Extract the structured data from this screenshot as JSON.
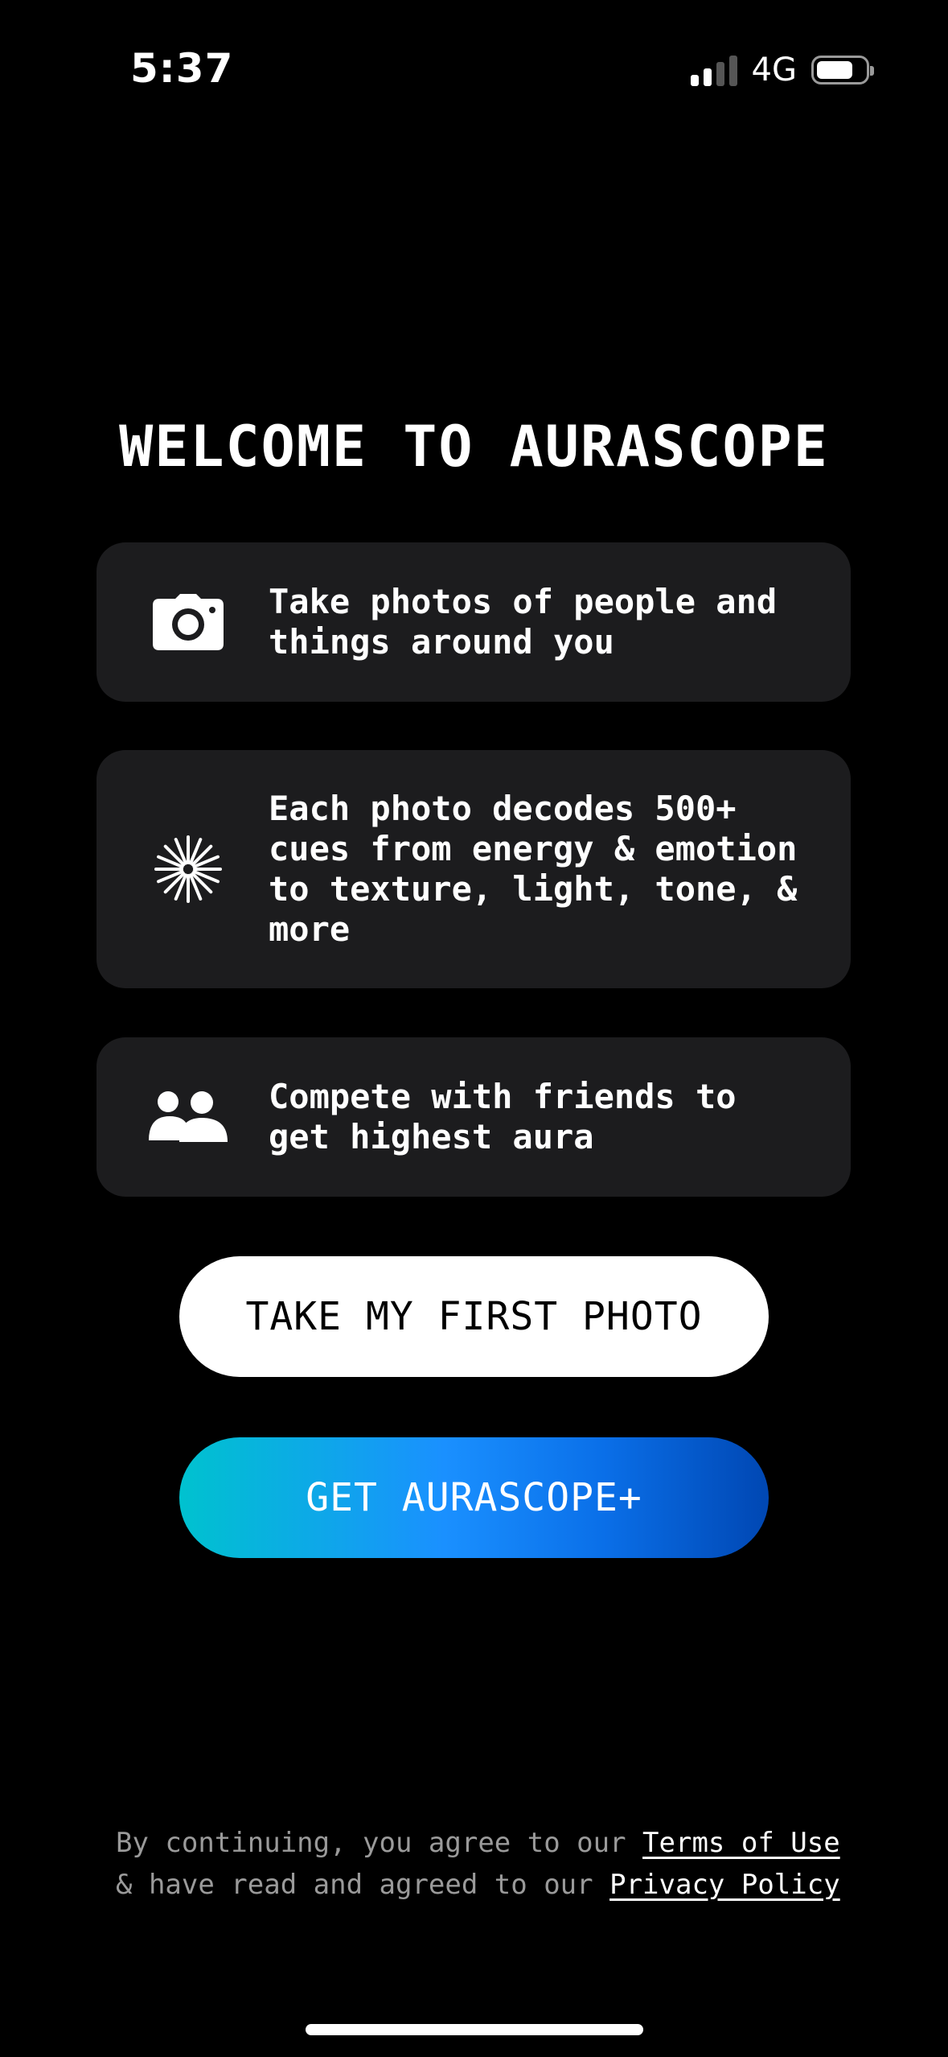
{
  "status_bar": {
    "time": "5:37",
    "network": "4G",
    "signal_bars_active": 2,
    "signal_bars_total": 4,
    "battery_level": 0.75
  },
  "title": "WELCOME TO AURASCOPE",
  "features": [
    {
      "icon": "camera-icon",
      "text": "Take photos of people and\nthings around you"
    },
    {
      "icon": "sparkle-burst-icon",
      "text": "Each photo decodes 500+\ncues from energy & emotion\nto texture, light, tone, &\nmore"
    },
    {
      "icon": "users-icon",
      "text": "Compete with friends to\nget highest aura"
    }
  ],
  "buttons": {
    "primary": "TAKE MY FIRST PHOTO",
    "upgrade": "GET AURASCOPE+"
  },
  "legal": {
    "line1_prefix": "By continuing, you agree to our",
    "terms_link": "Terms of Use",
    "line2_prefix": "& have read and agreed to our",
    "privacy_link": "Privacy Policy"
  },
  "colors": {
    "background": "#000000",
    "card": "#1c1c1e",
    "gradient_start": "#00c2cf",
    "gradient_end": "#0047b3"
  }
}
